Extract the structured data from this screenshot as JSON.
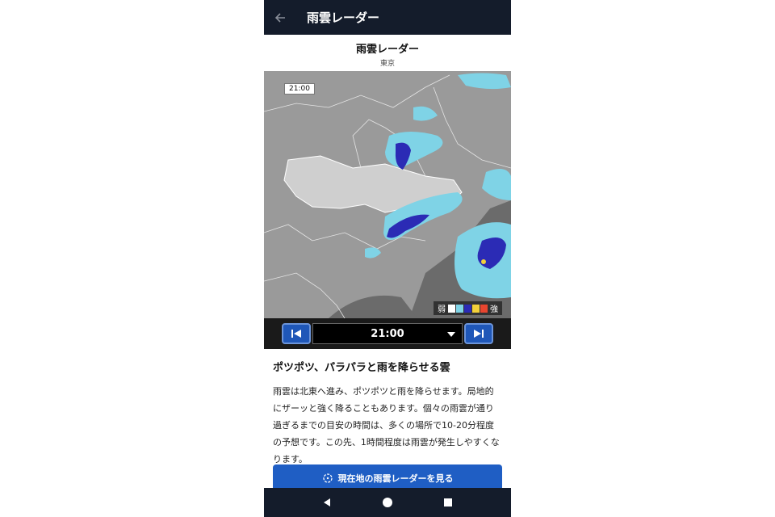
{
  "appbar": {
    "title": "雨雲レーダー",
    "back_icon": "arrow-left-icon"
  },
  "heading": {
    "title": "雨雲レーダー",
    "subtitle": "東京"
  },
  "map": {
    "time_badge": "21:00",
    "legend": {
      "weak_label": "弱",
      "strong_label": "強",
      "colors": [
        "#ffffff",
        "#7fd3e6",
        "#2b2bb5",
        "#f2d03a",
        "#e8452f"
      ]
    }
  },
  "time_control": {
    "selected_time": "21:00",
    "prev_icon": "skip-back-icon",
    "next_icon": "skip-forward-icon"
  },
  "forecast": {
    "title": "ポツポツ、パラパラと雨を降らせる雲",
    "body": "雨雲は北東へ進み、ポツポツと雨を降らせます。局地的にザーッと強く降ることもあります。個々の雨雲が通り過ぎるまでの目安の時間は、多くの場所で10-20分程度の予想です。この先、1時間程度は雨雲が発生しやすくなります。"
  },
  "radar_button": {
    "label": "現在地の雨雲レーダーを見る",
    "icon": "location-target-icon"
  },
  "navbar": {
    "back_icon": "triangle-back-icon",
    "home_icon": "circle-home-icon",
    "recent_icon": "square-recent-icon"
  },
  "colors": {
    "appbar_bg": "#141c2b",
    "accent": "#1f5ec4"
  }
}
